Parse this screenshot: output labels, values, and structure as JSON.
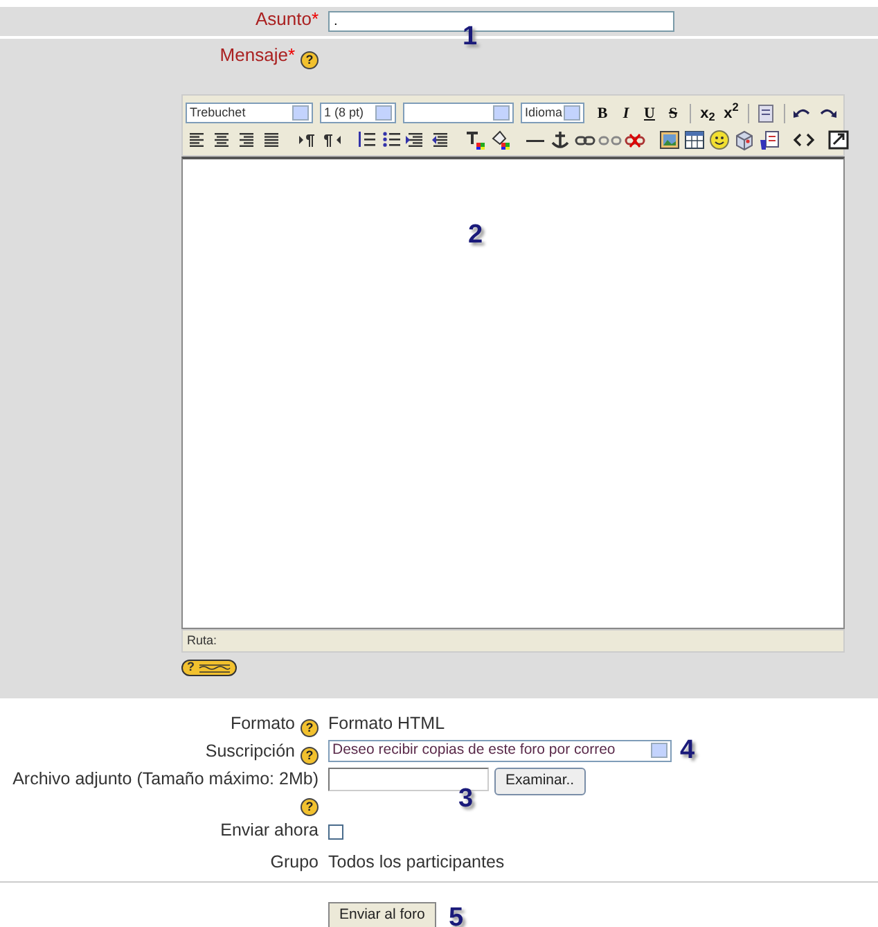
{
  "subject": {
    "label": "Asunto",
    "required_mark": "*",
    "value": "."
  },
  "message": {
    "label": "Mensaje",
    "required_mark": "*",
    "help": "?"
  },
  "editor": {
    "selects": [
      {
        "kind": "select",
        "value": "Trebuchet"
      },
      {
        "kind": "select",
        "value": "1 (8 pt)"
      },
      {
        "kind": "select"
      },
      {
        "kind": "select",
        "value": "Idioma"
      }
    ],
    "format_buttons": [
      "B",
      "I",
      "U",
      "S",
      "x$_{2}$",
      "x$^{2}$"
    ],
    "path_label": "Ruta:",
    "help_button": "?"
  },
  "format": {
    "label": "Formato",
    "help": "?",
    "value": "Formato HTML"
  },
  "subscription": {
    "label": "Suscripción",
    "help": "?",
    "value": "Deseo recibir copias de este foro por correo"
  },
  "attachment": {
    "label": "Archivo adjunto (Tamaño máximo: 2Mb)",
    "help": "?",
    "browse_button": "Examinar.."
  },
  "send_now": {
    "label": "Enviar ahora",
    "checked": false
  },
  "group": {
    "label": "Grupo",
    "value": "Todos los participantes"
  },
  "submit": "Enviar al foro",
  "callouts": [
    "1",
    "2",
    "3",
    "4",
    "5"
  ]
}
